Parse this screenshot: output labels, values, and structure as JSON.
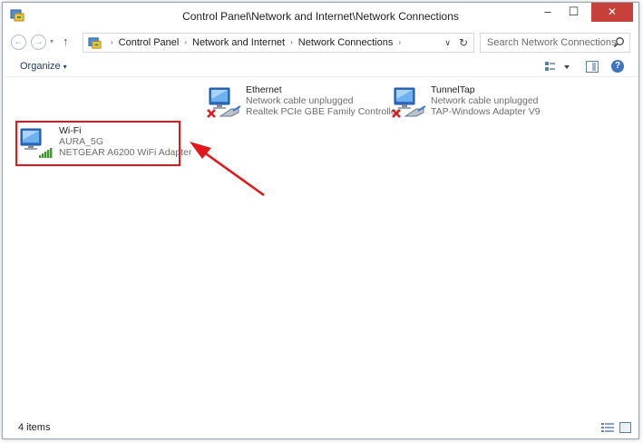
{
  "window": {
    "title": "Control Panel\\Network and Internet\\Network Connections",
    "minimize_label": "–",
    "maximize_label": "☐",
    "close_label": "✕"
  },
  "navigation": {
    "back_label": "←",
    "forward_label": "→",
    "recent_label": "▾",
    "up_label": "↑",
    "breadcrumbs": [
      "Control Panel",
      "Network and Internet",
      "Network Connections"
    ],
    "breadcrumb_separator": "›",
    "dropdown_label": "∨",
    "refresh_label": "↻",
    "search_placeholder": "Search Network Connections"
  },
  "command_bar": {
    "organize_label": "Organize",
    "organize_caret": "▾",
    "help_label": "?"
  },
  "connections": [
    {
      "name": "Ethernet",
      "status": "Network cable unplugged",
      "adapter": "Realtek PCIe GBE Family Controller",
      "icon": "ethernet-disconnected-icon"
    },
    {
      "name": "TunnelTap",
      "status": "Network cable unplugged",
      "adapter": "TAP-Windows Adapter V9",
      "icon": "tap-adapter-disconnected-icon"
    },
    {
      "name": "Wi-Fi",
      "status": "AURA_5G",
      "adapter": "NETGEAR A6200 WiFi Adapter",
      "icon": "wifi-connected-icon",
      "signal_bars": 5
    }
  ],
  "status_bar": {
    "items_count": "4 items"
  },
  "colors": {
    "close_button": "#c7403a",
    "highlight": "#e3161c",
    "link_blue": "#1e3f6e"
  }
}
